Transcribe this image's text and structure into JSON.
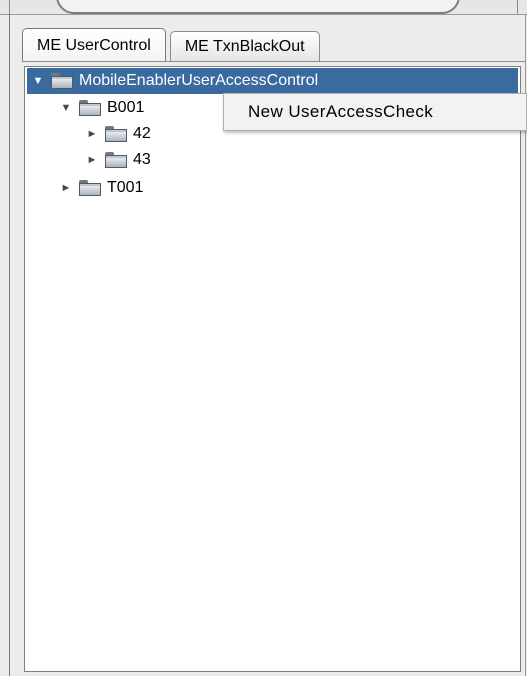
{
  "tabs": [
    {
      "label": "ME UserControl",
      "active": true
    },
    {
      "label": "ME TxnBlackOut",
      "active": false
    }
  ],
  "tree": {
    "root": {
      "label": "MobileEnablerUserAccessControl",
      "expanded": true,
      "selected": true
    },
    "b001": {
      "label": "B001",
      "expanded": true
    },
    "n42": {
      "label": "42",
      "expanded": false
    },
    "n43": {
      "label": "43",
      "expanded": false
    },
    "t001": {
      "label": "T001",
      "expanded": false
    }
  },
  "context_menu": {
    "items": [
      {
        "label": "New  UserAccessCheck"
      }
    ]
  },
  "icons": {
    "expanded": "triangle-down-icon",
    "collapsed": "triangle-right-icon",
    "folder": "folder-icon",
    "folder_open": "open-folder-icon"
  },
  "colors": {
    "selection": "#3a6ba0",
    "panel_bg": "#ffffff",
    "window_bg": "#ececec"
  }
}
